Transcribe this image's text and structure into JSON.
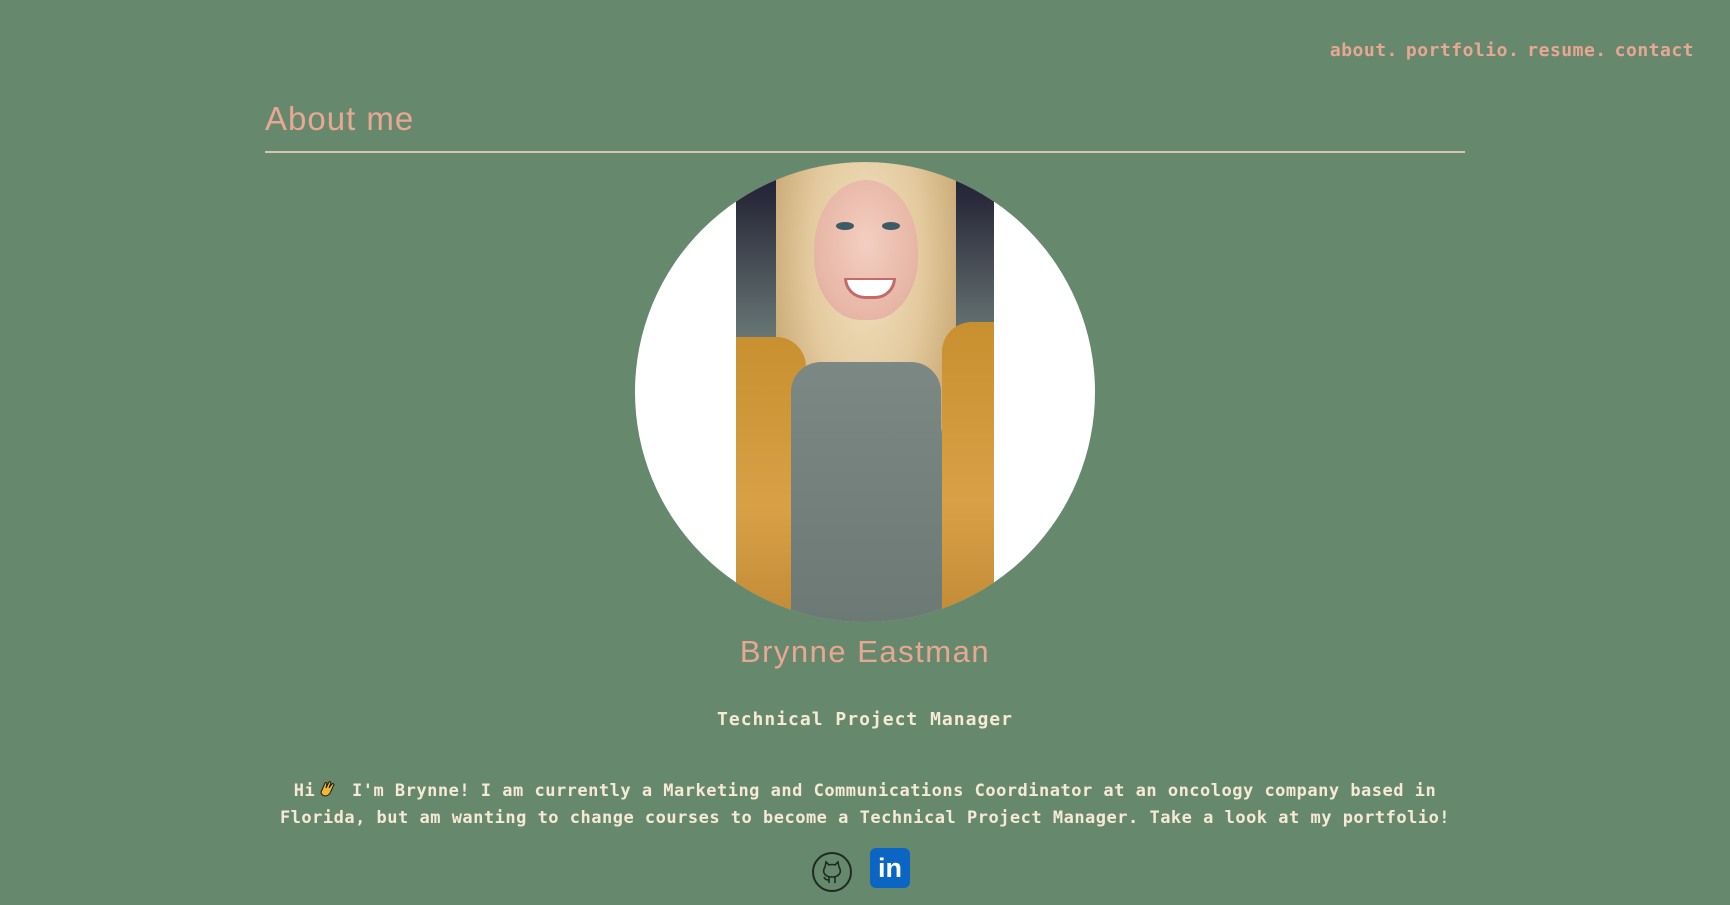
{
  "nav": {
    "items": [
      "about.",
      "portfolio.",
      "resume.",
      "contact"
    ]
  },
  "section": {
    "title": "About me"
  },
  "profile": {
    "name": "Brynne Eastman",
    "role": "Technical Project Manager",
    "bio_pre": "Hi",
    "bio_post": " I'm Brynne! I am currently a Marketing and Communications Coordinator at an oncology company based in Florida, but am wanting to change courses to become a Technical Project Manager. Take a look at my portfolio!"
  },
  "social": {
    "linkedin_label": "in",
    "icons": [
      "github-icon",
      "linkedin-icon"
    ]
  },
  "colors": {
    "background": "#66896d",
    "accent": "#e8a792",
    "text_light": "#f6ead6",
    "linkedin": "#0a66c2"
  }
}
